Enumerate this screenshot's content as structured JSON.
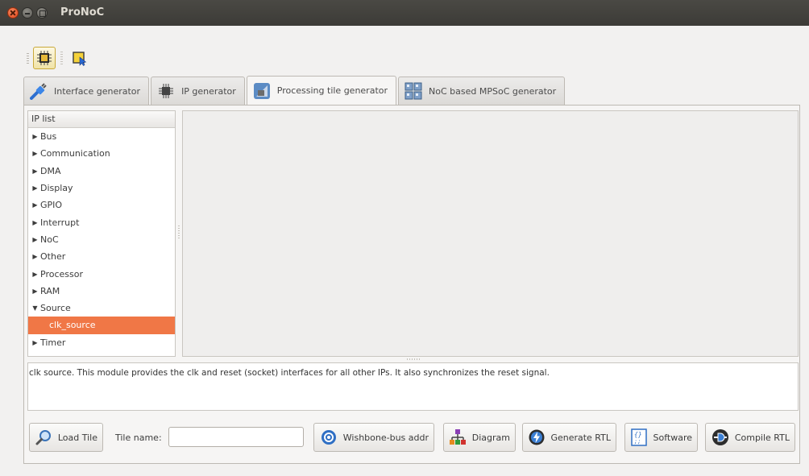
{
  "window": {
    "title": "ProNoC"
  },
  "toolbar": {
    "buttons": [
      {
        "icon": "chip-icon",
        "active": true
      },
      {
        "icon": "select-cursor-icon",
        "active": false
      }
    ]
  },
  "tabs": [
    {
      "label": "Interface generator",
      "icon": "interface-plug-icon"
    },
    {
      "label": "IP generator",
      "icon": "ip-chip-icon"
    },
    {
      "label": "Processing tile generator",
      "icon": "tile-icon",
      "active": true
    },
    {
      "label": "NoC based MPSoC generator",
      "icon": "noc-grid-icon"
    }
  ],
  "ip_list": {
    "header": "IP list",
    "items": [
      {
        "label": "Bus",
        "expanded": false
      },
      {
        "label": "Communication",
        "expanded": false
      },
      {
        "label": "DMA",
        "expanded": false
      },
      {
        "label": "Display",
        "expanded": false
      },
      {
        "label": "GPIO",
        "expanded": false
      },
      {
        "label": "Interrupt",
        "expanded": false
      },
      {
        "label": "NoC",
        "expanded": false
      },
      {
        "label": "Other",
        "expanded": false
      },
      {
        "label": "Processor",
        "expanded": false
      },
      {
        "label": "RAM",
        "expanded": false
      },
      {
        "label": "Source",
        "expanded": true
      },
      {
        "label": "clk_source",
        "child": true,
        "selected": true
      },
      {
        "label": "Timer",
        "expanded": false
      }
    ]
  },
  "description": "clk source. This module provides the clk and reset (socket) interfaces for all other IPs. It also synchronizes the reset signal.",
  "bottom": {
    "load_tile": "Load Tile",
    "tile_name_label": "Tile name:",
    "tile_name_value": "",
    "wishbone": "Wishbone-bus addr",
    "diagram": "Diagram",
    "generate_rtl": "Generate RTL",
    "software": "Software",
    "compile_rtl": "Compile RTL"
  },
  "colors": {
    "selection": "#f07746",
    "titlebar": "#3c3b37",
    "window_bg": "#f2f1f0"
  }
}
